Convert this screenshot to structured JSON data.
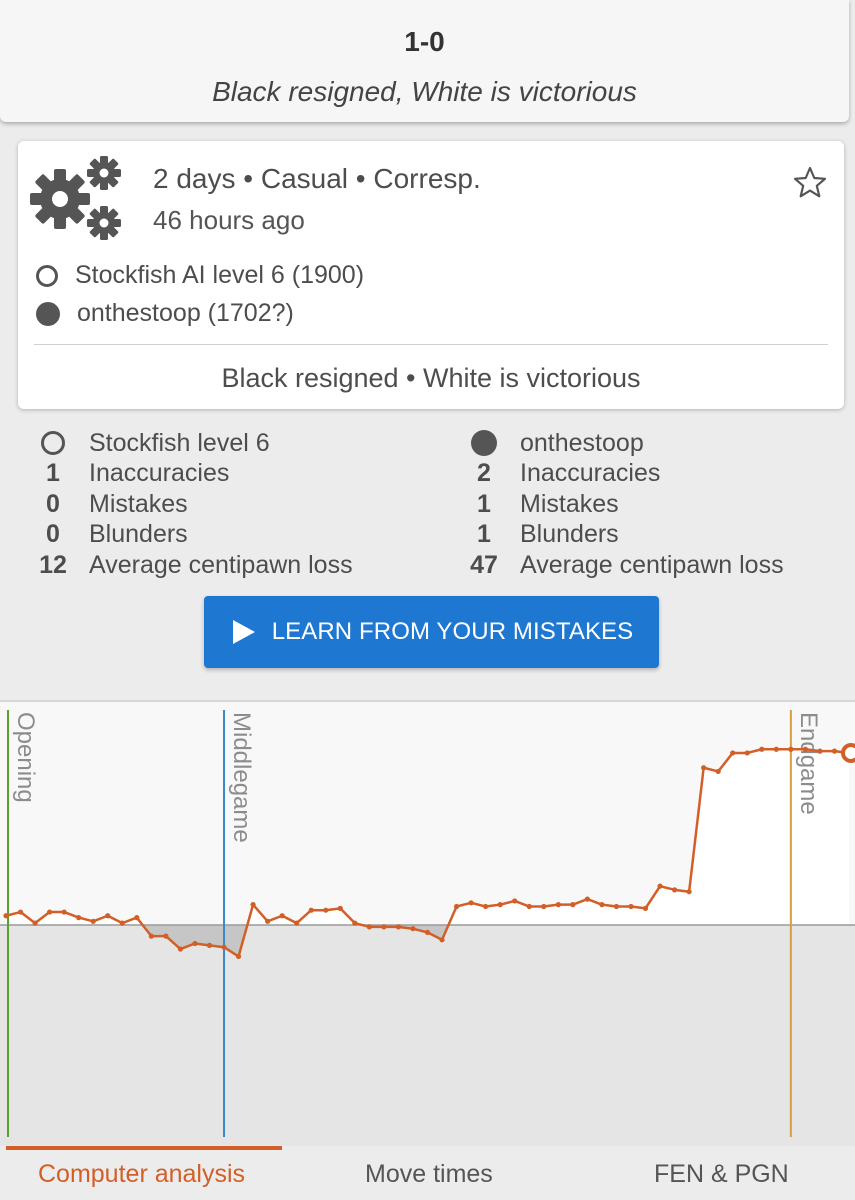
{
  "result": {
    "score": "1-0",
    "status": "Black resigned, White is victorious"
  },
  "game": {
    "icon": "gears-icon",
    "setup": "2 days • Casual • Corresp.",
    "age": "46 hours ago",
    "white_player": "Stockfish AI level 6 (1900)",
    "black_player": "onthestoop (1702?)",
    "status": "Black resigned • White is victorious"
  },
  "summary": {
    "white": {
      "name": "Stockfish level 6",
      "rows": [
        {
          "value": "1",
          "label": "Inaccuracies"
        },
        {
          "value": "0",
          "label": "Mistakes"
        },
        {
          "value": "0",
          "label": "Blunders"
        },
        {
          "value": "12",
          "label": "Average centipawn loss"
        }
      ]
    },
    "black": {
      "name": "onthestoop",
      "rows": [
        {
          "value": "2",
          "label": "Inaccuracies"
        },
        {
          "value": "1",
          "label": "Mistakes"
        },
        {
          "value": "1",
          "label": "Blunders"
        },
        {
          "value": "47",
          "label": "Average centipawn loss"
        }
      ]
    }
  },
  "learn_button": {
    "label": "LEARN FROM YOUR MISTAKES",
    "color": "#1e78d2"
  },
  "chart_data": {
    "type": "area",
    "phases": [
      {
        "label": "Opening",
        "ply": 0,
        "color": "#5aa02c"
      },
      {
        "label": "Middlegame",
        "ply": 15,
        "color": "#3a88c8"
      },
      {
        "label": "Endgame",
        "ply": 54,
        "color": "#d4a040"
      }
    ],
    "ylim": [
      -1,
      1
    ],
    "line_color": "#d25f27",
    "values": [
      0.05,
      0.07,
      0.01,
      0.07,
      0.07,
      0.04,
      0.02,
      0.05,
      0.01,
      0.04,
      -0.06,
      -0.06,
      -0.13,
      -0.1,
      -0.11,
      -0.12,
      -0.17,
      0.11,
      0.02,
      0.05,
      0.01,
      0.08,
      0.08,
      0.09,
      0.01,
      -0.01,
      -0.01,
      -0.01,
      -0.02,
      -0.04,
      -0.08,
      0.1,
      0.12,
      0.1,
      0.11,
      0.13,
      0.1,
      0.1,
      0.11,
      0.11,
      0.14,
      0.11,
      0.1,
      0.1,
      0.09,
      0.21,
      0.19,
      0.18,
      0.85,
      0.83,
      0.93,
      0.93,
      0.95,
      0.95,
      0.95,
      0.95,
      0.94,
      0.94,
      0.93
    ]
  },
  "tabs": {
    "computer_analysis": "Computer analysis",
    "move_times": "Move times",
    "fen_pgn": "FEN & PGN"
  }
}
